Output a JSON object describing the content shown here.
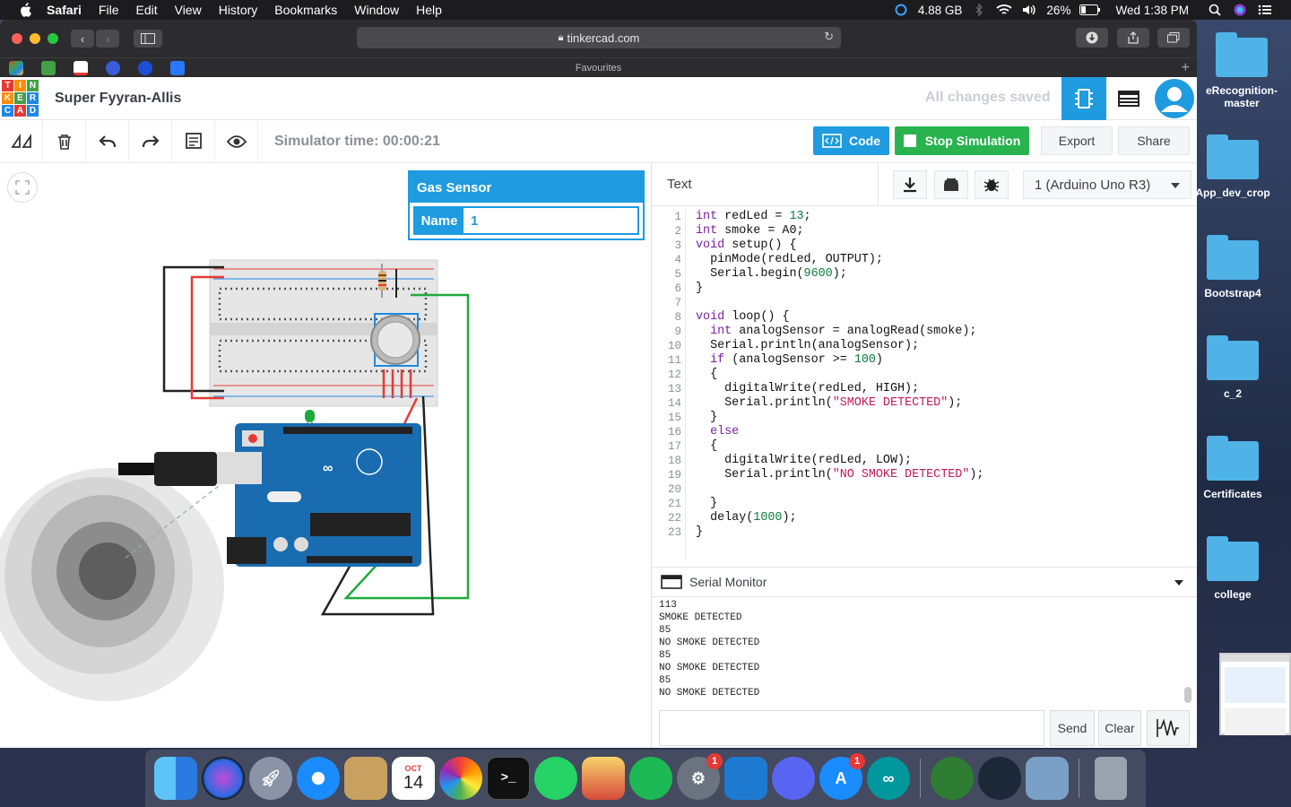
{
  "menubar": {
    "app": "Safari",
    "items": [
      "File",
      "Edit",
      "View",
      "History",
      "Bookmarks",
      "Window",
      "Help"
    ],
    "memory": "4.88 GB",
    "battery": "26%",
    "clock": "Wed 1:38 PM"
  },
  "browser": {
    "url": "tinkercad.com",
    "favourites_label": "Favourites"
  },
  "tinkercad": {
    "logo": [
      "T",
      "I",
      "N",
      "K",
      "E",
      "R",
      "C",
      "A",
      "D"
    ],
    "project_name": "Super Fyyran-Allis",
    "save_status": "All changes saved",
    "sim_time": "Simulator time: 00:00:21",
    "code_label": "Code",
    "stop_label": "Stop Simulation",
    "export_label": "Export",
    "share_label": "Share",
    "inspector": {
      "title": "Gas Sensor",
      "name_key": "Name",
      "name_value": "1"
    },
    "code_panel": {
      "mode": "Text",
      "board": "1 (Arduino Uno R3)",
      "line_numbers": [
        "1",
        "2",
        "3",
        "4",
        "5",
        "6",
        "7",
        "8",
        "9",
        "10",
        "11",
        "12",
        "13",
        "14",
        "15",
        "16",
        "17",
        "18",
        "19",
        "20",
        "21",
        "22",
        "23"
      ],
      "code_lines": [
        "int redLed = 13;",
        "int smoke = A0;",
        "void setup() {",
        "  pinMode(redLed, OUTPUT);",
        "  Serial.begin(9600);",
        "}",
        "",
        "void loop() {",
        "  int analogSensor = analogRead(smoke);",
        "  Serial.println(analogSensor);",
        "  if (analogSensor >= 100)",
        "  {",
        "    digitalWrite(redLed, HIGH);",
        "    Serial.println(\"SMOKE DETECTED\");",
        "  }",
        "  else",
        "  {",
        "    digitalWrite(redLed, LOW);",
        "    Serial.println(\"NO SMOKE DETECTED\");",
        "",
        "  }",
        "  delay(1000);",
        "}"
      ]
    },
    "serial_monitor": {
      "title": "Serial Monitor",
      "output": [
        "113",
        "SMOKE DETECTED",
        "85",
        "NO SMOKE DETECTED",
        "85",
        "NO SMOKE DETECTED",
        "85",
        "NO SMOKE DETECTED"
      ],
      "send_label": "Send",
      "clear_label": "Clear"
    }
  },
  "desktop_icons": [
    "eRecognition-\nmaster",
    "App_dev_crop",
    "Bootstrap4",
    "c_2",
    "Certificates",
    "college"
  ],
  "dock": {
    "calendar_month": "OCT",
    "calendar_day": "14",
    "badge_settings": "1",
    "badge_appstore": "1"
  }
}
